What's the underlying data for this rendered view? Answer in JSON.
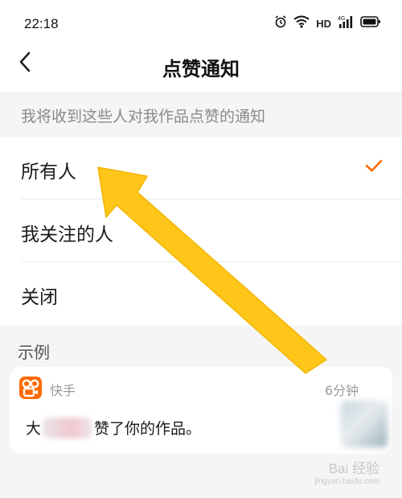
{
  "status_bar": {
    "time": "22:18",
    "hd": "HD",
    "icons": [
      "alarm-icon",
      "wifi-icon",
      "signal-4g-icon",
      "battery-icon"
    ]
  },
  "header": {
    "title": "点赞通知",
    "back_icon": "chevron-left-icon"
  },
  "caption": "我将收到这些人对我作品点赞的通知",
  "options": [
    {
      "label": "所有人",
      "selected": true
    },
    {
      "label": "我关注的人",
      "selected": false
    },
    {
      "label": "关闭",
      "selected": false
    }
  ],
  "example": {
    "section_title": "示例",
    "app_name": "快手",
    "time": "6分钟",
    "message_prefix": "大",
    "message_suffix": "赞了你的作品。"
  },
  "colors": {
    "accent": "#ff6a00",
    "annotation_arrow": "#ffc61a"
  },
  "watermark": {
    "main": "Bai 经验",
    "sub": "jingyan.baidu.com"
  }
}
